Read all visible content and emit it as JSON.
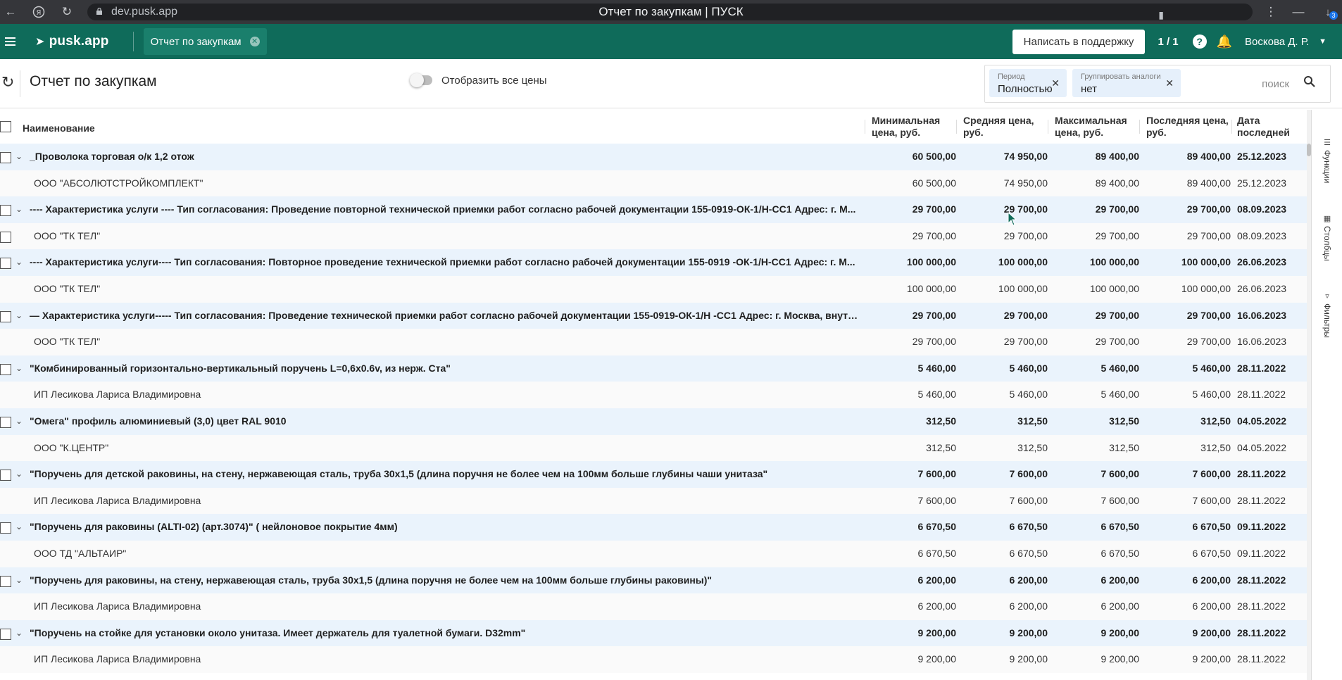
{
  "browser": {
    "url": "dev.pusk.app",
    "tab_title": "Отчет по закупкам | ПУСК",
    "badge": "3"
  },
  "header": {
    "logo": "pusk.app",
    "tab_label": "Отчет по закупкам",
    "support_button": "Написать в поддержку",
    "counter": "1 / 1",
    "help": "?",
    "user": "Воскова Д. Р."
  },
  "toolbar": {
    "title": "Отчет по закупкам",
    "toggle_label": "Отобразить все цены",
    "filters": [
      {
        "caption": "Период",
        "value": "Полностью"
      },
      {
        "caption": "Группировать аналоги",
        "value": "нет"
      }
    ],
    "search_placeholder": "поиск"
  },
  "table": {
    "columns": {
      "name": "Наименование",
      "min": [
        "Минимальная",
        "цена, руб."
      ],
      "avg": [
        "Средняя цена,",
        "руб."
      ],
      "max": [
        "Максимальная",
        "цена, руб."
      ],
      "last": [
        "Последняя цена,",
        "руб."
      ],
      "date": [
        "Дата",
        "последней"
      ]
    },
    "rows": [
      {
        "type": "group",
        "name": "_Проволока торговая о/к 1,2 отож",
        "min": "60 500,00",
        "avg": "74 950,00",
        "max": "89 400,00",
        "last": "89 400,00",
        "date": "25.12.2023"
      },
      {
        "type": "item",
        "name": "ООО \"АБСОЛЮТСТРОЙКОМПЛЕКТ\"",
        "min": "60 500,00",
        "avg": "74 950,00",
        "max": "89 400,00",
        "last": "89 400,00",
        "date": "25.12.2023"
      },
      {
        "type": "group",
        "name": "---- Характеристика услуги ---- Тип согласования: Проведение повторной технической приемки работ согласно рабочей документации 155-0919-ОК-1/Н-СС1 Адрес: г. М...",
        "min": "29 700,00",
        "avg": "29 700,00",
        "max": "29 700,00",
        "last": "29 700,00",
        "date": "08.09.2023"
      },
      {
        "type": "item",
        "name": "ООО \"ТК ТЕЛ\"",
        "min": "29 700,00",
        "avg": "29 700,00",
        "max": "29 700,00",
        "last": "29 700,00",
        "date": "08.09.2023",
        "checkbox": true
      },
      {
        "type": "group",
        "name": "---- Характеристика услуги---- Тип согласования: Повторное проведение технической приемки работ согласно рабочей документации 155-0919 -ОК-1/Н-СС1 Адрес: г. М...",
        "min": "100 000,00",
        "avg": "100 000,00",
        "max": "100 000,00",
        "last": "100 000,00",
        "date": "26.06.2023"
      },
      {
        "type": "item",
        "name": "ООО \"ТК ТЕЛ\"",
        "min": "100 000,00",
        "avg": "100 000,00",
        "max": "100 000,00",
        "last": "100 000,00",
        "date": "26.06.2023"
      },
      {
        "type": "group",
        "name": "— Характеристика услуги----- Тип согласования: Проведение технической приемки работ согласно рабочей документации 155-0919-ОК-1/Н -СС1 Адрес: г. Москва, внутр...",
        "min": "29 700,00",
        "avg": "29 700,00",
        "max": "29 700,00",
        "last": "29 700,00",
        "date": "16.06.2023"
      },
      {
        "type": "item",
        "name": "ООО \"ТК ТЕЛ\"",
        "min": "29 700,00",
        "avg": "29 700,00",
        "max": "29 700,00",
        "last": "29 700,00",
        "date": "16.06.2023"
      },
      {
        "type": "group",
        "name": "\"Комбинированный горизонтально-вертикальный поручень L=0,6х0.6v, из нерж. Ста\"",
        "min": "5 460,00",
        "avg": "5 460,00",
        "max": "5 460,00",
        "last": "5 460,00",
        "date": "28.11.2022"
      },
      {
        "type": "item",
        "name": "ИП Лесикова Лариса Владимировна",
        "min": "5 460,00",
        "avg": "5 460,00",
        "max": "5 460,00",
        "last": "5 460,00",
        "date": "28.11.2022"
      },
      {
        "type": "group",
        "name": "\"Омега\" профиль алюминиевый (3,0) цвет RAL 9010",
        "min": "312,50",
        "avg": "312,50",
        "max": "312,50",
        "last": "312,50",
        "date": "04.05.2022"
      },
      {
        "type": "item",
        "name": "ООО \"К.ЦЕНТР\"",
        "min": "312,50",
        "avg": "312,50",
        "max": "312,50",
        "last": "312,50",
        "date": "04.05.2022"
      },
      {
        "type": "group",
        "name": "\"Поручень для детской раковины, на стену, нержавеющая сталь, труба 30х1,5 (длина поручня не более чем на 100мм больше глубины чаши унитаза\"",
        "min": "7 600,00",
        "avg": "7 600,00",
        "max": "7 600,00",
        "last": "7 600,00",
        "date": "28.11.2022"
      },
      {
        "type": "item",
        "name": "ИП Лесикова Лариса Владимировна",
        "min": "7 600,00",
        "avg": "7 600,00",
        "max": "7 600,00",
        "last": "7 600,00",
        "date": "28.11.2022"
      },
      {
        "type": "group",
        "name": "\"Поручень для раковины (ALTI-02) (арт.3074)\" ( нейлоновое покрытие 4мм)",
        "min": "6 670,50",
        "avg": "6 670,50",
        "max": "6 670,50",
        "last": "6 670,50",
        "date": "09.11.2022"
      },
      {
        "type": "item",
        "name": "ООО ТД \"АЛЬТАИР\"",
        "min": "6 670,50",
        "avg": "6 670,50",
        "max": "6 670,50",
        "last": "6 670,50",
        "date": "09.11.2022"
      },
      {
        "type": "group",
        "name": "\"Поручень для раковины, на стену, нержавеющая сталь, труба 30х1,5 (длина поручня не более чем на 100мм больше глубины раковины)\"",
        "min": "6 200,00",
        "avg": "6 200,00",
        "max": "6 200,00",
        "last": "6 200,00",
        "date": "28.11.2022"
      },
      {
        "type": "item",
        "name": "ИП Лесикова Лариса Владимировна",
        "min": "6 200,00",
        "avg": "6 200,00",
        "max": "6 200,00",
        "last": "6 200,00",
        "date": "28.11.2022"
      },
      {
        "type": "group",
        "name": "\"Поручень на стойке для установки около унитаза. Имеет держатель для туалетной бумаги. D32mm\"",
        "min": "9 200,00",
        "avg": "9 200,00",
        "max": "9 200,00",
        "last": "9 200,00",
        "date": "28.11.2022"
      },
      {
        "type": "item",
        "name": "ИП Лесикова Лариса Владимировна",
        "min": "9 200,00",
        "avg": "9 200,00",
        "max": "9 200,00",
        "last": "9 200,00",
        "date": "28.11.2022"
      }
    ]
  },
  "side_panel": {
    "functions": "Функции",
    "columns": "Столбцы",
    "filters": "Фильтры"
  },
  "colors": {
    "header_bg": "#0f6b5a",
    "group_row_bg": "#eaf3fc",
    "chip_bg": "#e6f0fb"
  }
}
